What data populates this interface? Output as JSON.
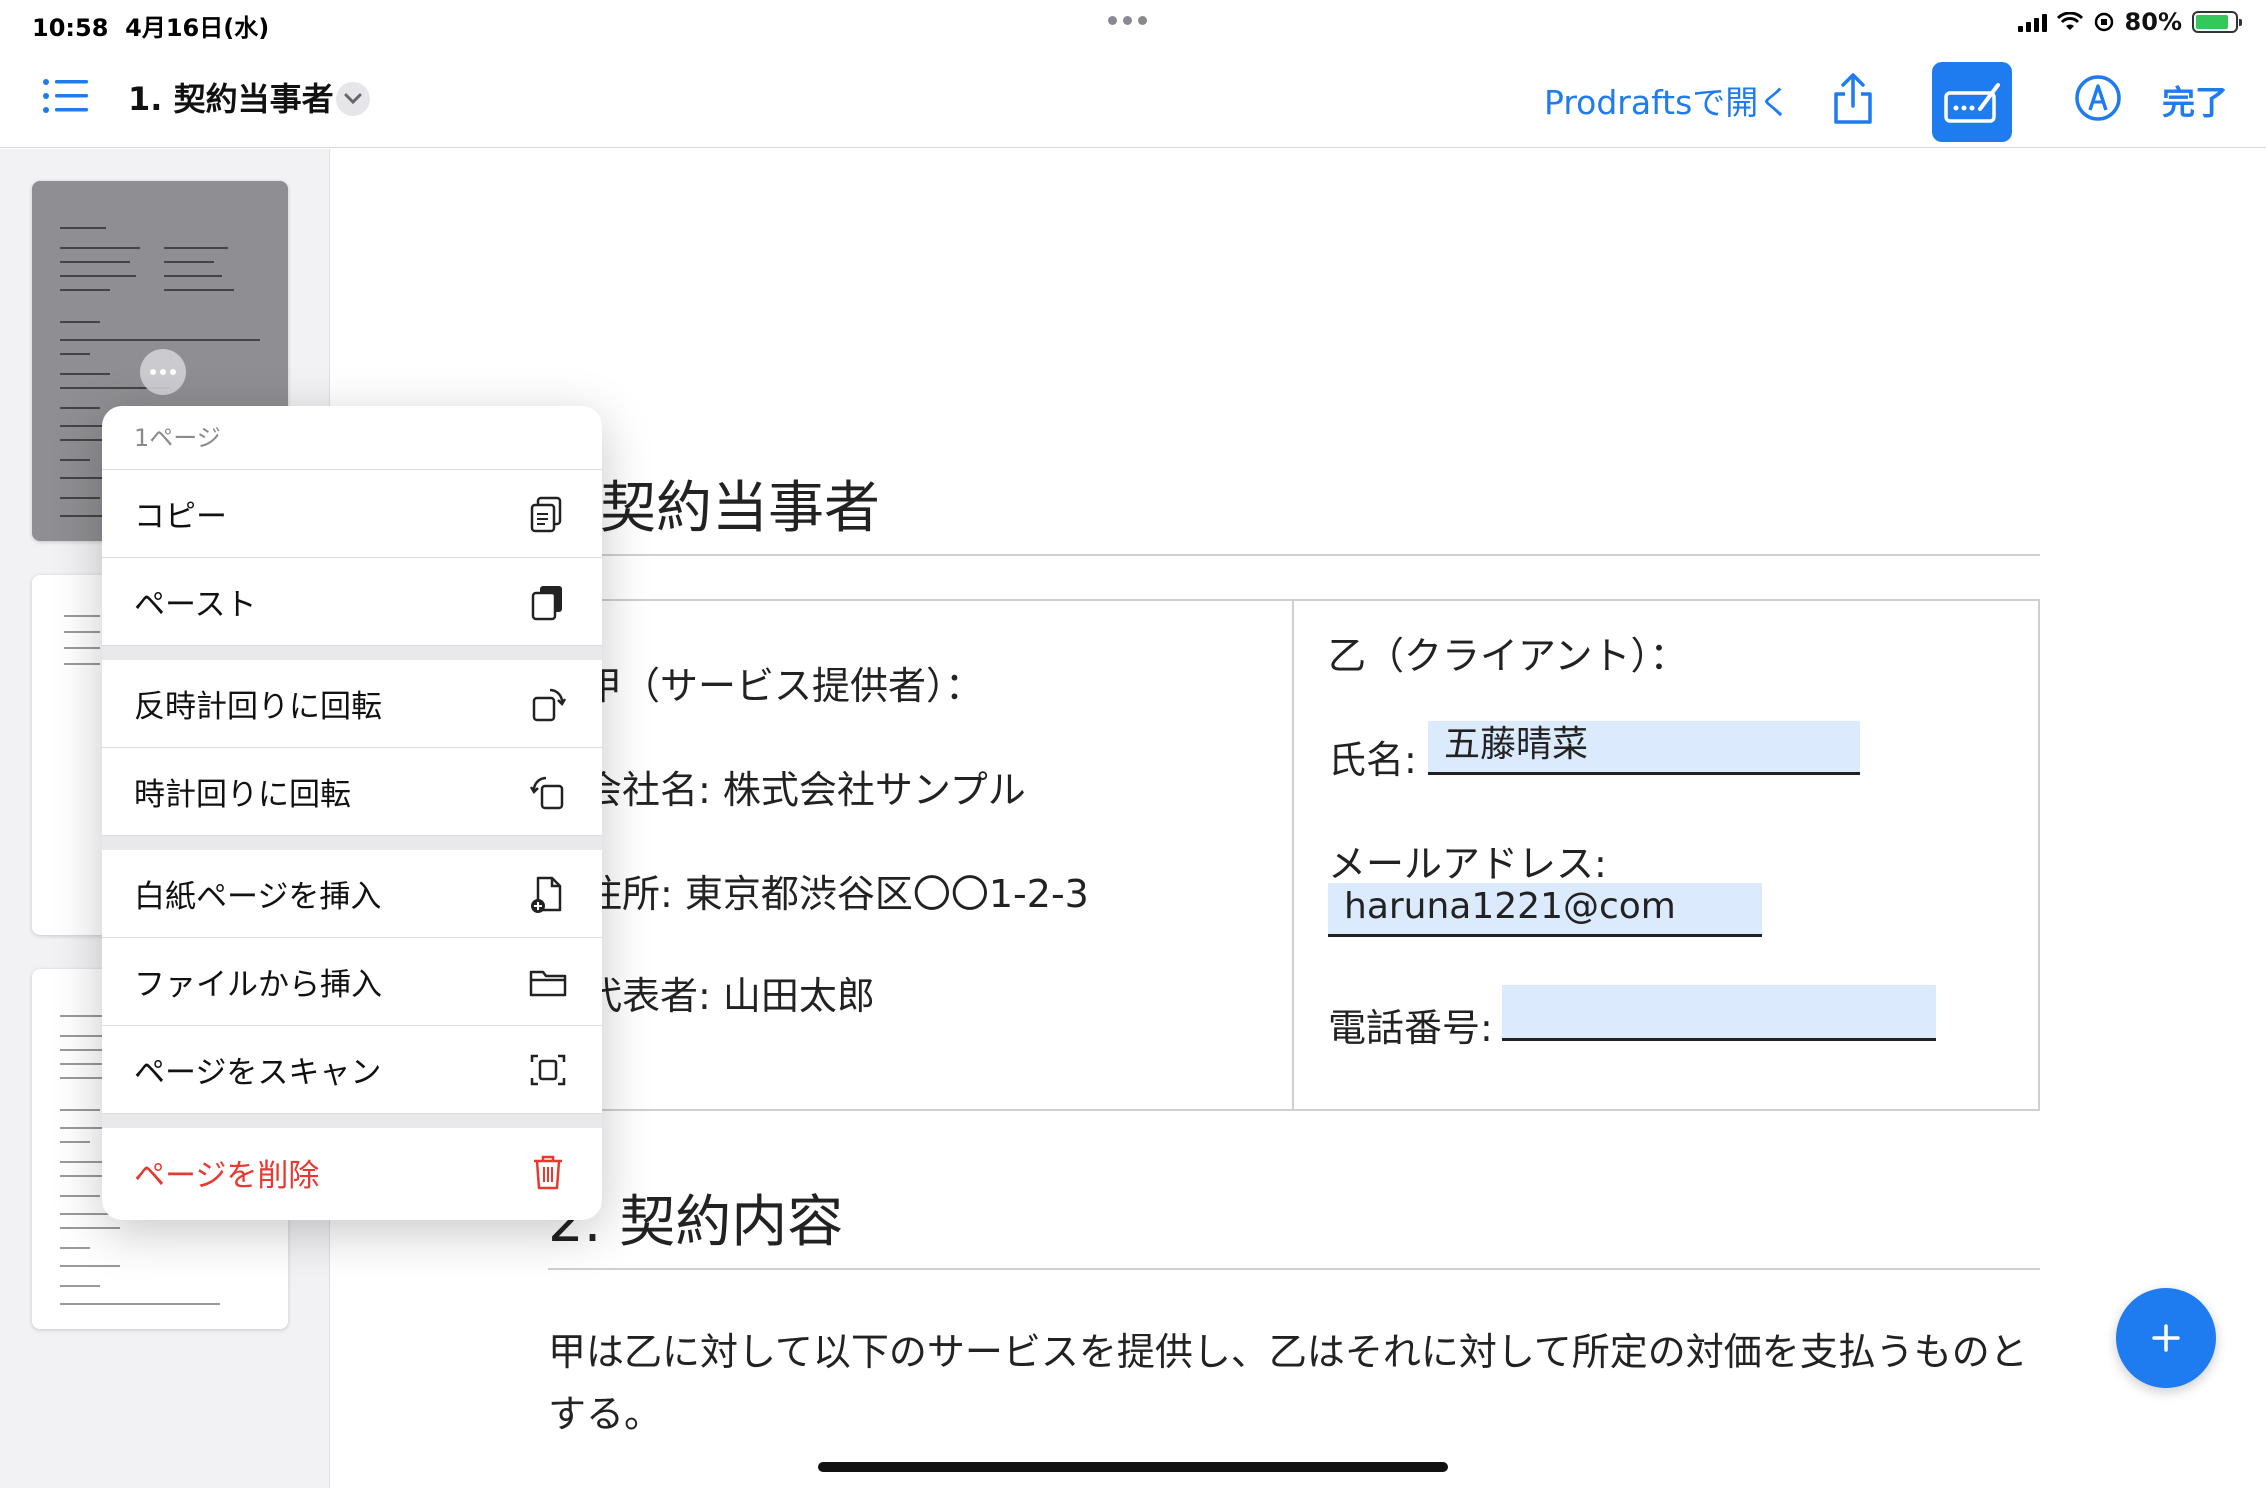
{
  "status": {
    "time": "10:58",
    "date": "4月16日(水)",
    "battery": "80%"
  },
  "toolbar": {
    "title": "1. 契約当事者",
    "open_in": "Prodraftsで開く",
    "done": "完了",
    "icons": [
      "list-icon",
      "chevron-down-icon",
      "share-icon",
      "markup-icon",
      "pen-icon"
    ]
  },
  "context_menu": {
    "header": "1ページ",
    "items": [
      {
        "label": "コピー",
        "icon": "copy-icon"
      },
      {
        "label": "ペースト",
        "icon": "paste-icon"
      },
      {
        "label": "反時計回りに回転",
        "icon": "rotate-left-icon"
      },
      {
        "label": "時計回りに回転",
        "icon": "rotate-right-icon"
      },
      {
        "label": "白紙ページを挿入",
        "icon": "add-page-icon"
      },
      {
        "label": "ファイルから挿入",
        "icon": "folder-icon"
      },
      {
        "label": "ページをスキャン",
        "icon": "scan-icon"
      },
      {
        "label": "ページを削除",
        "icon": "trash-icon"
      }
    ]
  },
  "document": {
    "section1_title": "契約当事者",
    "party_a": {
      "heading": "甲（サービス提供者）：",
      "company": "会社名: 株式会社サンプル",
      "address": "住所: 東京都渋谷区〇〇1-2-3",
      "representative": "代表者: 山田太郎"
    },
    "party_b": {
      "heading": "乙（クライアント）：",
      "name_label": "氏名:",
      "name_value": "五藤晴菜",
      "email_label": "メールアドレス:",
      "email_value": "haruna1221@com",
      "phone_label": "電話番号:",
      "phone_value": ""
    },
    "section2_title": "2. 契約内容",
    "section2_line1": "甲は乙に対して以下のサービスを提供し、乙はそれに対して所定の対価を支払うものと",
    "section2_line2": "する。"
  },
  "colors": {
    "accent": "#1e7bf0",
    "danger": "#e8382f",
    "field_bg": "#dbeafc"
  }
}
